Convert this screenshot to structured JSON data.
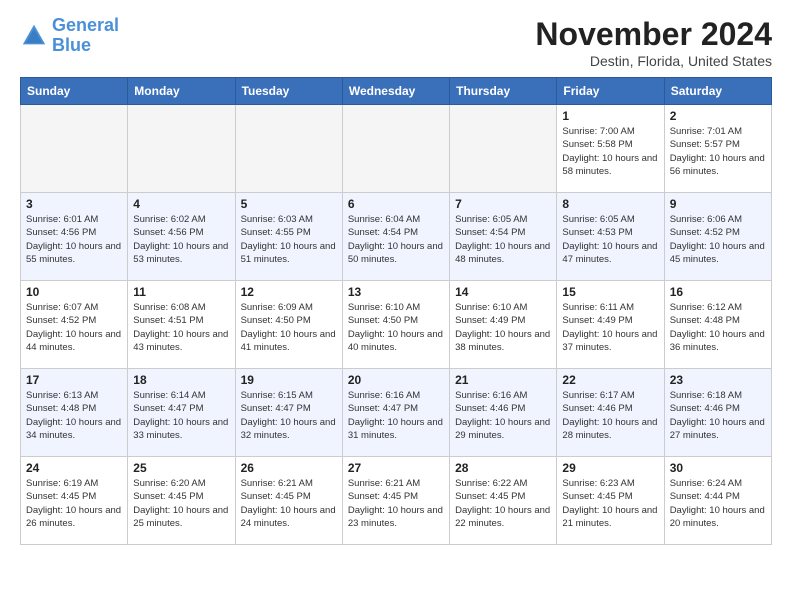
{
  "header": {
    "logo_line1": "General",
    "logo_line2": "Blue",
    "month": "November 2024",
    "location": "Destin, Florida, United States"
  },
  "weekdays": [
    "Sunday",
    "Monday",
    "Tuesday",
    "Wednesday",
    "Thursday",
    "Friday",
    "Saturday"
  ],
  "weeks": [
    [
      {
        "day": "",
        "info": ""
      },
      {
        "day": "",
        "info": ""
      },
      {
        "day": "",
        "info": ""
      },
      {
        "day": "",
        "info": ""
      },
      {
        "day": "",
        "info": ""
      },
      {
        "day": "1",
        "info": "Sunrise: 7:00 AM\nSunset: 5:58 PM\nDaylight: 10 hours and 58 minutes."
      },
      {
        "day": "2",
        "info": "Sunrise: 7:01 AM\nSunset: 5:57 PM\nDaylight: 10 hours and 56 minutes."
      }
    ],
    [
      {
        "day": "3",
        "info": "Sunrise: 6:01 AM\nSunset: 4:56 PM\nDaylight: 10 hours and 55 minutes."
      },
      {
        "day": "4",
        "info": "Sunrise: 6:02 AM\nSunset: 4:56 PM\nDaylight: 10 hours and 53 minutes."
      },
      {
        "day": "5",
        "info": "Sunrise: 6:03 AM\nSunset: 4:55 PM\nDaylight: 10 hours and 51 minutes."
      },
      {
        "day": "6",
        "info": "Sunrise: 6:04 AM\nSunset: 4:54 PM\nDaylight: 10 hours and 50 minutes."
      },
      {
        "day": "7",
        "info": "Sunrise: 6:05 AM\nSunset: 4:54 PM\nDaylight: 10 hours and 48 minutes."
      },
      {
        "day": "8",
        "info": "Sunrise: 6:05 AM\nSunset: 4:53 PM\nDaylight: 10 hours and 47 minutes."
      },
      {
        "day": "9",
        "info": "Sunrise: 6:06 AM\nSunset: 4:52 PM\nDaylight: 10 hours and 45 minutes."
      }
    ],
    [
      {
        "day": "10",
        "info": "Sunrise: 6:07 AM\nSunset: 4:52 PM\nDaylight: 10 hours and 44 minutes."
      },
      {
        "day": "11",
        "info": "Sunrise: 6:08 AM\nSunset: 4:51 PM\nDaylight: 10 hours and 43 minutes."
      },
      {
        "day": "12",
        "info": "Sunrise: 6:09 AM\nSunset: 4:50 PM\nDaylight: 10 hours and 41 minutes."
      },
      {
        "day": "13",
        "info": "Sunrise: 6:10 AM\nSunset: 4:50 PM\nDaylight: 10 hours and 40 minutes."
      },
      {
        "day": "14",
        "info": "Sunrise: 6:10 AM\nSunset: 4:49 PM\nDaylight: 10 hours and 38 minutes."
      },
      {
        "day": "15",
        "info": "Sunrise: 6:11 AM\nSunset: 4:49 PM\nDaylight: 10 hours and 37 minutes."
      },
      {
        "day": "16",
        "info": "Sunrise: 6:12 AM\nSunset: 4:48 PM\nDaylight: 10 hours and 36 minutes."
      }
    ],
    [
      {
        "day": "17",
        "info": "Sunrise: 6:13 AM\nSunset: 4:48 PM\nDaylight: 10 hours and 34 minutes."
      },
      {
        "day": "18",
        "info": "Sunrise: 6:14 AM\nSunset: 4:47 PM\nDaylight: 10 hours and 33 minutes."
      },
      {
        "day": "19",
        "info": "Sunrise: 6:15 AM\nSunset: 4:47 PM\nDaylight: 10 hours and 32 minutes."
      },
      {
        "day": "20",
        "info": "Sunrise: 6:16 AM\nSunset: 4:47 PM\nDaylight: 10 hours and 31 minutes."
      },
      {
        "day": "21",
        "info": "Sunrise: 6:16 AM\nSunset: 4:46 PM\nDaylight: 10 hours and 29 minutes."
      },
      {
        "day": "22",
        "info": "Sunrise: 6:17 AM\nSunset: 4:46 PM\nDaylight: 10 hours and 28 minutes."
      },
      {
        "day": "23",
        "info": "Sunrise: 6:18 AM\nSunset: 4:46 PM\nDaylight: 10 hours and 27 minutes."
      }
    ],
    [
      {
        "day": "24",
        "info": "Sunrise: 6:19 AM\nSunset: 4:45 PM\nDaylight: 10 hours and 26 minutes."
      },
      {
        "day": "25",
        "info": "Sunrise: 6:20 AM\nSunset: 4:45 PM\nDaylight: 10 hours and 25 minutes."
      },
      {
        "day": "26",
        "info": "Sunrise: 6:21 AM\nSunset: 4:45 PM\nDaylight: 10 hours and 24 minutes."
      },
      {
        "day": "27",
        "info": "Sunrise: 6:21 AM\nSunset: 4:45 PM\nDaylight: 10 hours and 23 minutes."
      },
      {
        "day": "28",
        "info": "Sunrise: 6:22 AM\nSunset: 4:45 PM\nDaylight: 10 hours and 22 minutes."
      },
      {
        "day": "29",
        "info": "Sunrise: 6:23 AM\nSunset: 4:45 PM\nDaylight: 10 hours and 21 minutes."
      },
      {
        "day": "30",
        "info": "Sunrise: 6:24 AM\nSunset: 4:44 PM\nDaylight: 10 hours and 20 minutes."
      }
    ]
  ]
}
